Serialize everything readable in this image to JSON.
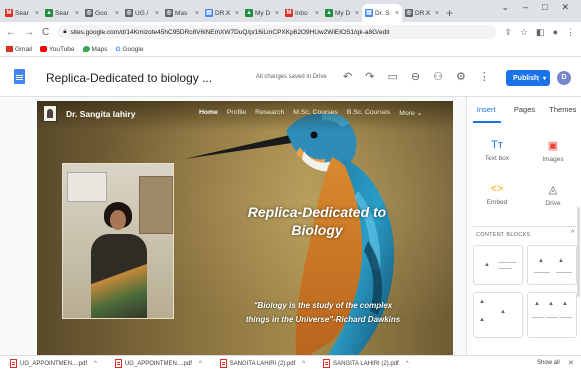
{
  "browser": {
    "tabs": [
      {
        "label": "Sear",
        "icon": "gmail-icon",
        "color": "#d93025",
        "glyph": "M"
      },
      {
        "label": "Sear",
        "icon": "drive-icon",
        "color": "#1e8e3e",
        "glyph": "▲"
      },
      {
        "label": "Goo",
        "icon": "globe-icon",
        "color": "#5f6368",
        "glyph": "◎"
      },
      {
        "label": "UG /",
        "icon": "globe-icon",
        "color": "#5f6368",
        "glyph": "◎"
      },
      {
        "label": "Mas",
        "icon": "globe-icon",
        "color": "#5f6368",
        "glyph": "◎"
      },
      {
        "label": "DR.K",
        "icon": "sites-icon",
        "color": "#4285f4",
        "glyph": "▤"
      },
      {
        "label": "My D",
        "icon": "drive-icon",
        "color": "#1e8e3e",
        "glyph": "▲"
      },
      {
        "label": "Inbo",
        "icon": "gmail-icon",
        "color": "#d93025",
        "glyph": "M"
      },
      {
        "label": "My D",
        "icon": "drive-icon",
        "color": "#1e8e3e",
        "glyph": "▲"
      },
      {
        "label": "Dr. S",
        "icon": "sites-icon",
        "color": "#4285f4",
        "glyph": "▤",
        "active": true
      },
      {
        "label": "DR.K",
        "icon": "globe-icon",
        "color": "#5f6368",
        "glyph": "◎"
      }
    ],
    "new_tab": "+",
    "window_controls": [
      "⌄",
      "–",
      "□",
      "✕"
    ],
    "url": "sites.google.com/d/14Kmizote45hC95DRc8V6iNEmXW7DuQ/p/16iLmCPXKp62O9HUw2WiEIOS1/qk-a8G/edit",
    "toolbar_icons": [
      "⇪",
      "☆",
      "◧",
      "●",
      "⋮"
    ],
    "bookmarks": [
      {
        "label": "Gmail",
        "color": "#d93025"
      },
      {
        "label": "YouTube",
        "color": "#ff0000"
      },
      {
        "label": "Maps",
        "color": "#34a853"
      },
      {
        "label": "Google",
        "color": "#4285f4"
      }
    ]
  },
  "sites_editor": {
    "doc_title": "Replica-Dedicated to biology ...",
    "save_status": "All changes saved in Drive",
    "icons": [
      "↶",
      "↷",
      "▭",
      "⊖",
      "⚇",
      "⚙",
      "⋮"
    ],
    "publish_label": "Publish",
    "publish_dropdown": "▾",
    "avatar_letter": "D",
    "avatar_color": "#7986cb"
  },
  "site": {
    "name": "Dr. Sangita lahiry",
    "nav": [
      "Home",
      "Profile",
      "Research",
      "M.Sc. Courses",
      "B.Sc. Courses",
      "More ⌄"
    ],
    "headline_line1": "Replica-Dedicated to",
    "headline_line2": "Biology",
    "quote_line1": "\"Biology is the study of the complex",
    "quote_line2": "things in the Universe\"-Richard Dawkins"
  },
  "panel": {
    "tabs": [
      "Insert",
      "Pages",
      "Themes"
    ],
    "items": [
      {
        "label": "Text box",
        "glyph": "Tт",
        "color": "#1a73e8"
      },
      {
        "label": "Images",
        "glyph": "▣",
        "color": "#ea4335"
      },
      {
        "label": "Embed",
        "glyph": "<>",
        "color": "#f9ab00"
      },
      {
        "label": "Drive",
        "glyph": "◬",
        "color": "#5f6368"
      }
    ],
    "content_blocks_label": "CONTENT BLOCKS",
    "collapse": "^"
  },
  "downloads": {
    "files": [
      "UG_APPOINTMEN....pdf",
      "UG_APPOINTMEN....pdf",
      "SANGITA LAHIRI (2).pdf",
      "SANGITA LAHIRI (2).pdf"
    ],
    "caret": "^",
    "show_all": "Show all",
    "close": "✕"
  },
  "colors": {
    "accent": "#1a73e8",
    "tabstrip": "#dee1e6"
  }
}
